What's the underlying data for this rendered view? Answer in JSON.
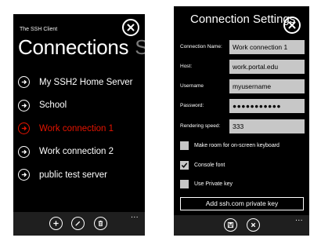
{
  "connections_screen": {
    "app_title": "The SSH Client",
    "title": "Connections",
    "next_pivot": "Se",
    "connections": [
      {
        "label": "My SSH2 Home Server",
        "selected": false
      },
      {
        "label": "School",
        "selected": false
      },
      {
        "label": "Work connection 1",
        "selected": true
      },
      {
        "label": "Work connection 2",
        "selected": false
      },
      {
        "label": "public test server",
        "selected": false
      }
    ],
    "appbar": {
      "buttons": [
        "add-icon",
        "edit-icon",
        "delete-icon"
      ],
      "more": "..."
    },
    "accent_color": "#e51400"
  },
  "settings_screen": {
    "title": "Connection Settings",
    "fields": {
      "connection_name": {
        "label": "Connection Name:",
        "value": "Work connection 1"
      },
      "host": {
        "label": "Host:",
        "value": "work.portal.edu"
      },
      "username": {
        "label": "Username",
        "value": "myusername"
      },
      "password": {
        "label": "Password:",
        "value": "●●●●●●●●●●●"
      },
      "rendering_speed": {
        "label": "Rendering speed:",
        "value": "333"
      }
    },
    "checkboxes": {
      "room_for_keyboard": {
        "label": "Make room for on-screen keyboard",
        "checked": false
      },
      "console_font": {
        "label": "Console font",
        "checked": true
      },
      "private_key": {
        "label": "Use Private key",
        "checked": false
      }
    },
    "add_key_button": "Add ssh.com private key",
    "appbar": {
      "buttons": [
        "save-icon",
        "cancel-icon"
      ],
      "more": "..."
    }
  }
}
